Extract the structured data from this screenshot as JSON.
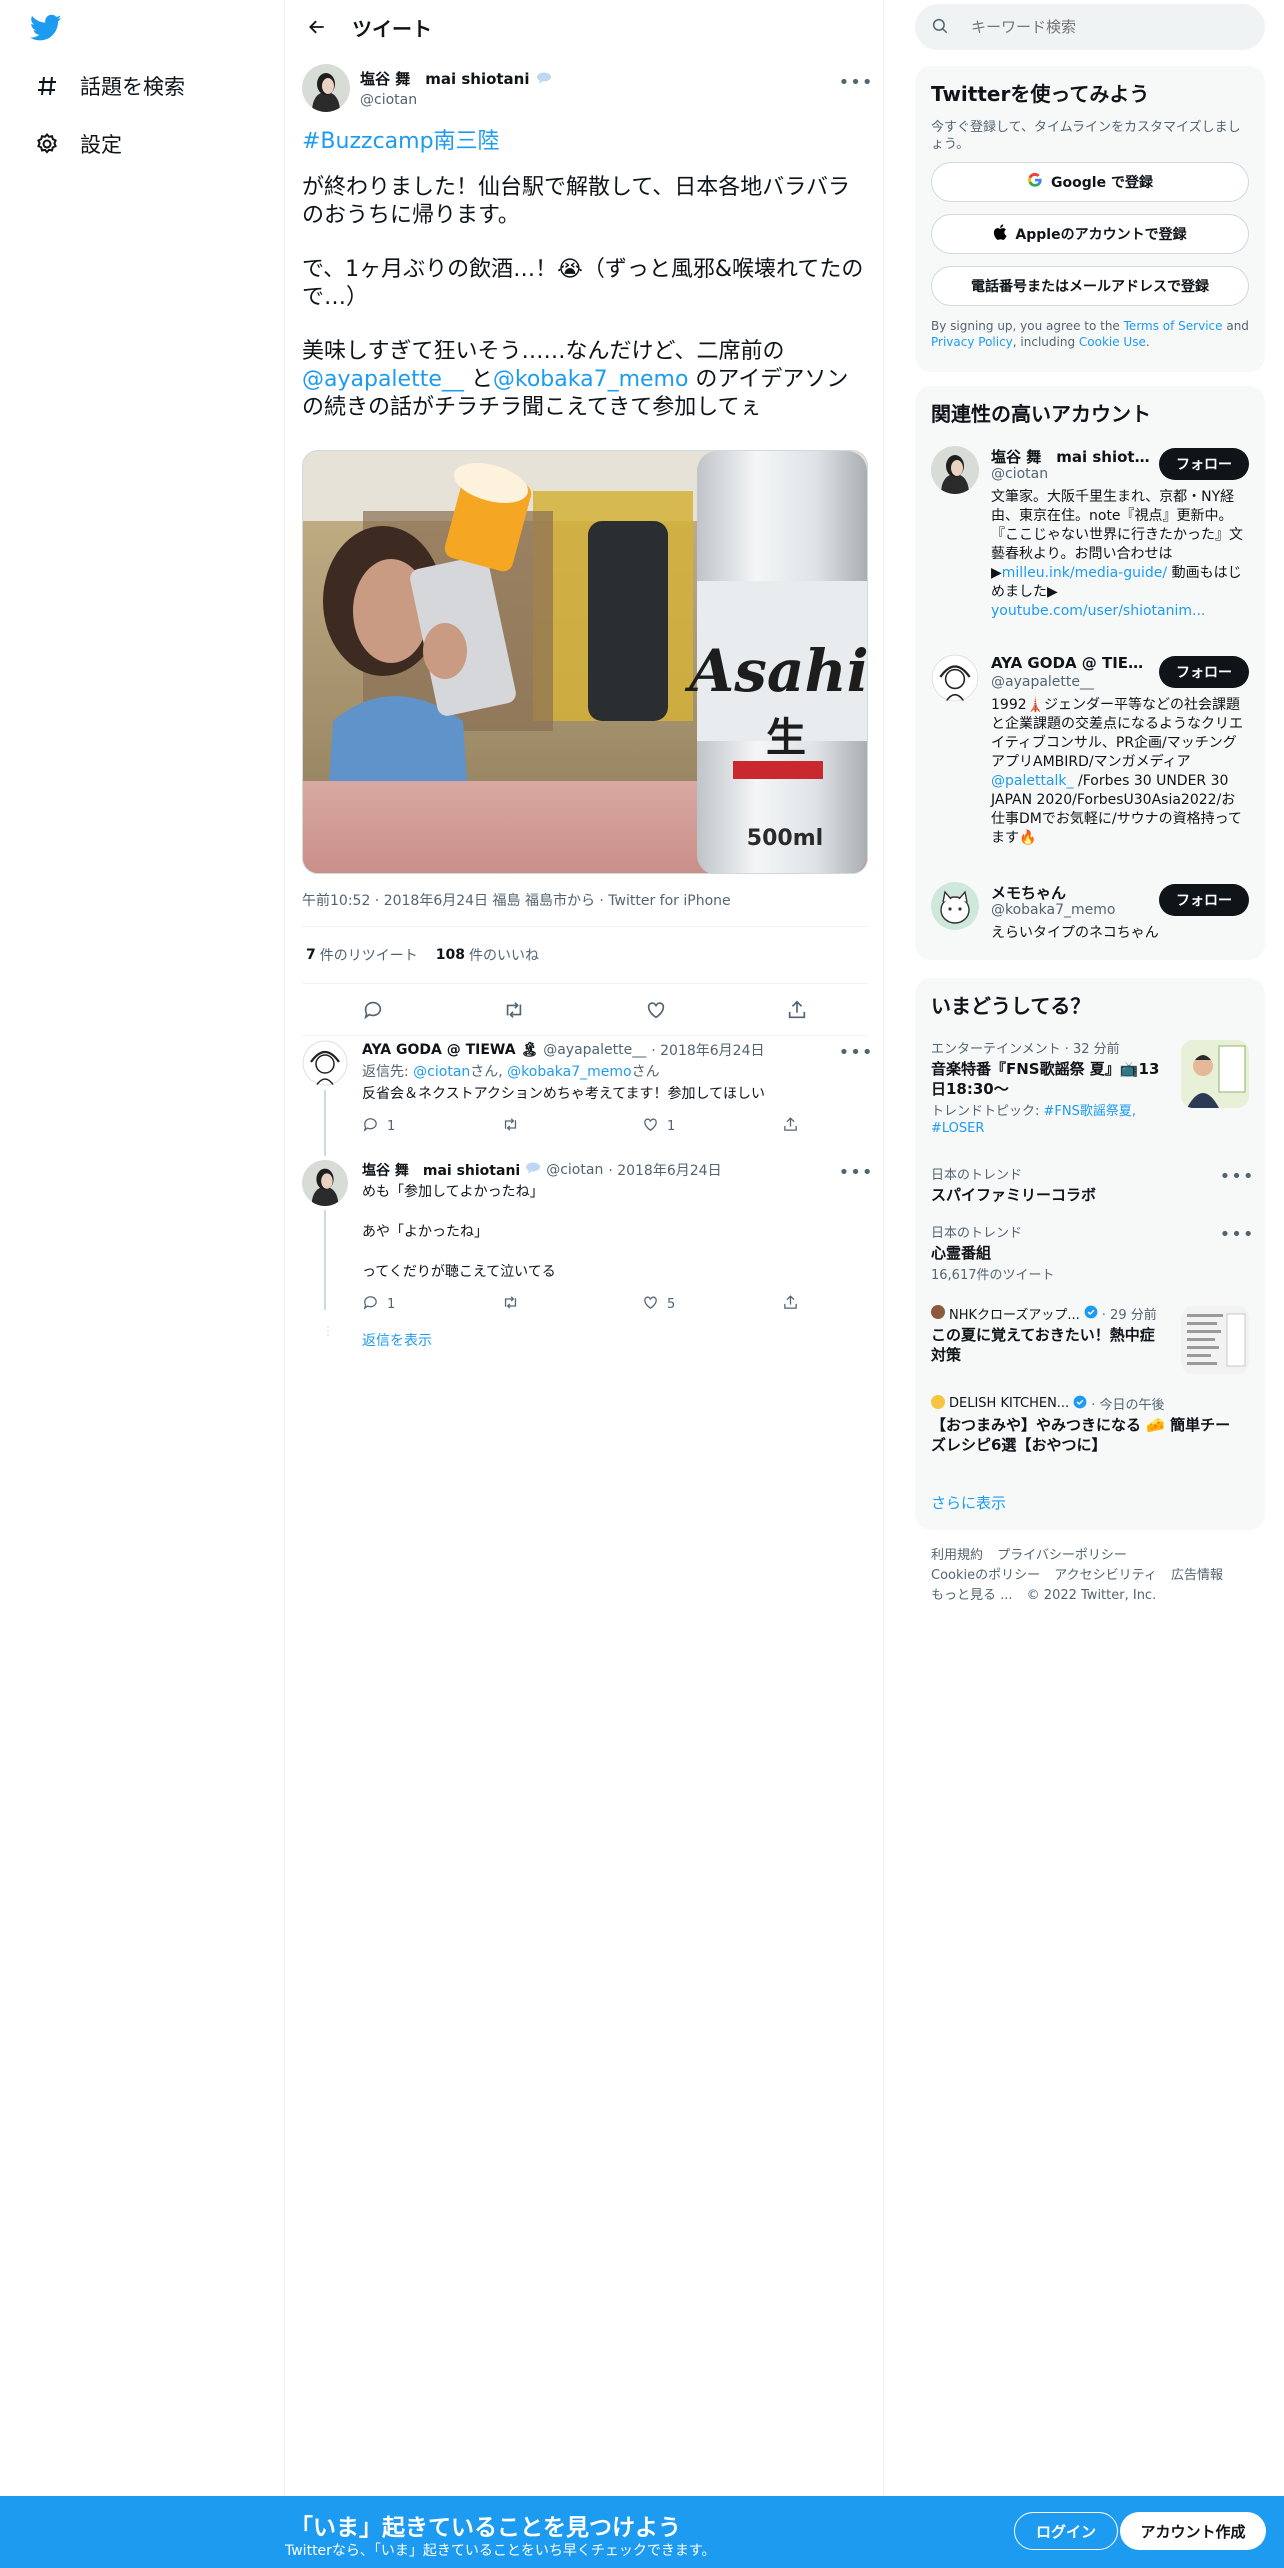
{
  "colors": {
    "accent": "#1d9bf0",
    "text": "#0f1419",
    "muted": "#536471",
    "panel": "#f7f9f9"
  },
  "nav": {
    "logo": "twitter-bird-icon",
    "items": [
      {
        "icon": "hashtag-icon",
        "label": "話題を検索"
      },
      {
        "icon": "gear-icon",
        "label": "設定"
      }
    ]
  },
  "header": {
    "title": "ツイート"
  },
  "tweet": {
    "display_name": "塩谷 舞　mai shiotani",
    "handle": "@ciotan",
    "hashtag": "#Buzzcamp南三陸",
    "para1": "が終わりました！仙台駅で解散して、日本各地バラバラのおうちに帰ります。",
    "para2": "で、1ヶ月ぶりの飲酒…！😭（ずっと風邪&喉壊れてたので…）",
    "para3_a": "美味しすぎて狂いそう……なんだけど、二席前の",
    "mention1": "@ayapalette__",
    "para3_b": " と",
    "mention2": "@kobaka7_memo",
    "para3_c": " のアイデアソンの続きの話がチラチラ聞こえてきて参加してぇ",
    "meta": "午前10:52 · 2018年6月24日 福島 福島市から · Twitter for iPhone",
    "retweets_count": "7",
    "retweets_label": "件のリツイート",
    "likes_count": "108",
    "likes_label": "件のいいね",
    "image_can_text": "Asahi",
    "image_can_kanji": "生",
    "image_can_volume": "500ml"
  },
  "replies": [
    {
      "display_name": "AYA GODA @ TIEWA 🏝",
      "handle": "@ayapalette__",
      "date": "· 2018年6月24日",
      "reply_to_prefix": "返信先:",
      "reply_to_1": "@ciotan",
      "reply_to_mid": "さん,",
      "reply_to_2": "@kobaka7_memo",
      "reply_to_suffix": "さん",
      "text": "反省会＆ネクストアクションめちゃ考えてます！参加してほしい",
      "replies": "1",
      "likes": "1"
    },
    {
      "display_name": "塩谷 舞　mai shiotani",
      "handle": "@ciotan",
      "date": "· 2018年6月24日",
      "text_1": "めも「参加してよかったね」",
      "text_2": "あや「よかったね」",
      "text_3": "ってくだりが聴こえて泣いてる",
      "replies": "1",
      "likes": "5",
      "show_replies": "返信を表示"
    }
  ],
  "search": {
    "placeholder": "キーワード検索"
  },
  "signup_card": {
    "title": "Twitterを使ってみよう",
    "subtitle": "今すぐ登録して、タイムラインをカスタマイズしましょう。",
    "google_btn": "Google で登録",
    "apple_btn": "Appleのアカウントで登録",
    "phone_btn": "電話番号またはメールアドレスで登録",
    "legal_1": "By signing up, you agree to the ",
    "legal_terms": "Terms of Service",
    "legal_2": " and ",
    "legal_privacy": "Privacy Policy",
    "legal_3": ", including ",
    "legal_cookie": "Cookie Use",
    "legal_4": "."
  },
  "related": {
    "title": "関連性の高いアカウント",
    "follow_label": "フォロー",
    "accounts": [
      {
        "name": "塩谷 舞　mai shiotan...",
        "handle": "@ciotan",
        "bio": "文筆家。大阪千里生まれ、京都・NY経由、東京在住。note『視点』更新中。『ここじゃない世界に行きたかった』文藝春秋より。お問い合わせは▶",
        "link1": "milleu.ink/media-guide/",
        "bio2": " 動画もはじめました▶",
        "link2": "youtube.com/user/shiotanim..."
      },
      {
        "name": "AYA GODA @ TIEW...",
        "handle": "@ayapalette__",
        "bio": "1992🗼ジェンダー平等などの社会課題と企業課題の交差点になるようなクリエイティブコンサル、PR企画/マッチングアプリAMBIRD/マンガメディア",
        "link1": "@palettalk_",
        "bio2": " /Forbes 30 UNDER 30 JAPAN 2020/ForbesU30Asia2022/お仕事DMでお気軽に/サウナの資格持ってます🔥"
      },
      {
        "name": "メモちゃん",
        "handle": "@kobaka7_memo",
        "bio": "えらいタイプのネコちゃん"
      }
    ]
  },
  "trends": {
    "title": "いまどうしてる？",
    "items": [
      {
        "meta": "エンターテインメント · 32 分前",
        "name": "音楽特番『FNS歌謡祭 夏』📺13日18:30～",
        "sub_prefix": "トレンドトピック: ",
        "sub_links": "#FNS歌謡祭夏, #LOSER"
      },
      {
        "meta": "日本のトレンド",
        "name": "スパイファミリーコラボ"
      },
      {
        "meta": "日本のトレンド",
        "name": "心霊番組",
        "sub": "16,617件のツイート"
      },
      {
        "source": "NHKクローズアップ...",
        "time": "· 29 分前",
        "name": "この夏に覚えておきたい！熱中症対策"
      },
      {
        "source": "DELISH KITCHEN...",
        "time": "· 今日の午後",
        "name": "【おつまみや】やみつきになる 🧀 簡単チーズレシピ6選【おやつに】"
      }
    ],
    "show_more": "さらに表示"
  },
  "footer": {
    "links": [
      "利用規約",
      "プライバシーポリシー",
      "Cookieのポリシー",
      "アクセシビリティ",
      "広告情報",
      "もっと見る ...",
      "© 2022 Twitter, Inc."
    ]
  },
  "banner": {
    "title": "「いま」起きていることを見つけよう",
    "subtitle": "Twitterなら、「いま」起きていることをいち早くチェックできます。",
    "login": "ログイン",
    "signup": "アカウント作成"
  }
}
